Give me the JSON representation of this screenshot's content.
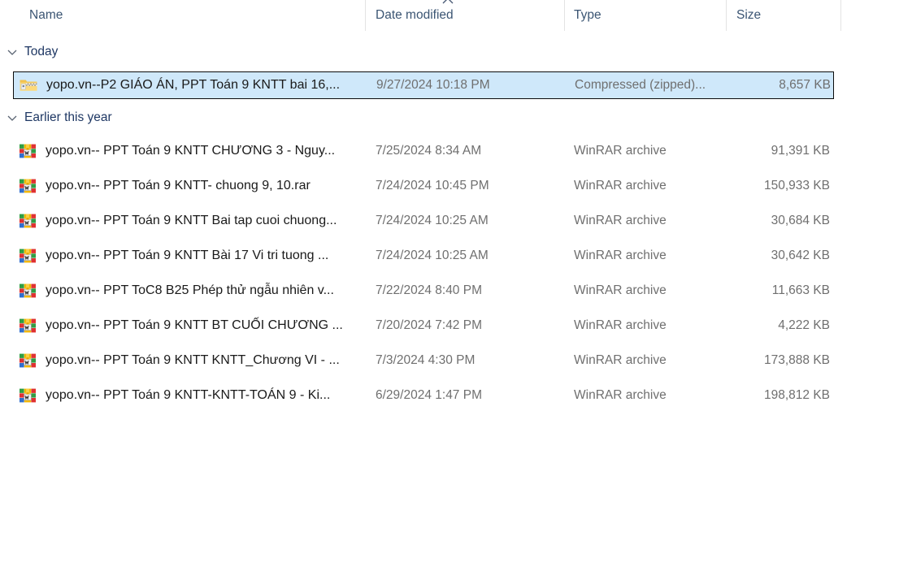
{
  "window": {
    "view": "details",
    "background_color": "#ffffff"
  },
  "colors": {
    "selection_fill": "#cfe8fa",
    "selection_border": "#0b0b0b",
    "header_text": "#3b5573",
    "group_header_text": "#1f3864",
    "name_text": "#1a1a1a",
    "secondary_text": "#6f6f6f",
    "divider": "#e3e3e3"
  },
  "columns": [
    {
      "key": "name",
      "label": "Name",
      "sorted": false
    },
    {
      "key": "date_modified",
      "label": "Date modified",
      "sorted": true,
      "sort_direction": "ascending",
      "sort_icon": "chevron-up-icon"
    },
    {
      "key": "type",
      "label": "Type",
      "sorted": false
    },
    {
      "key": "size",
      "label": "Size",
      "sorted": false
    }
  ],
  "groups": [
    {
      "label": "Today",
      "expanded": true,
      "chevron_icon": "chevron-down-icon",
      "items": [
        {
          "name": "yopo.vn--P2 GIÁO ÁN, PPT Toán 9 KNTT bai 16,...",
          "date_modified": "9/27/2024 10:18 PM",
          "type": "Compressed (zipped)...",
          "size": "8,657 KB",
          "icon": "zipped-folder-icon",
          "selected": true
        }
      ]
    },
    {
      "label": "Earlier this year",
      "expanded": true,
      "chevron_icon": "chevron-down-icon",
      "items": [
        {
          "name": "yopo.vn-- PPT Toán 9 KNTT CHƯƠNG 3 - Nguy...",
          "date_modified": "7/25/2024 8:34 AM",
          "type": "WinRAR archive",
          "size": "91,391 KB",
          "icon": "winrar-archive-icon",
          "selected": false
        },
        {
          "name": "yopo.vn-- PPT Toán 9 KNTT- chuong 9, 10.rar",
          "date_modified": "7/24/2024 10:45 PM",
          "type": "WinRAR archive",
          "size": "150,933 KB",
          "icon": "winrar-archive-icon",
          "selected": false
        },
        {
          "name": "yopo.vn-- PPT Toán 9 KNTT Bai tap cuoi chuong...",
          "date_modified": "7/24/2024 10:25 AM",
          "type": "WinRAR archive",
          "size": "30,684 KB",
          "icon": "winrar-archive-icon",
          "selected": false
        },
        {
          "name": "yopo.vn-- PPT Toán 9 KNTT Bài 17 Vi tri tuong ...",
          "date_modified": "7/24/2024 10:25 AM",
          "type": "WinRAR archive",
          "size": "30,642 KB",
          "icon": "winrar-archive-icon",
          "selected": false
        },
        {
          "name": "yopo.vn-- PPT ToC8 B25 Phép thử ngẫu nhiên v...",
          "date_modified": "7/22/2024 8:40 PM",
          "type": "WinRAR archive",
          "size": "11,663 KB",
          "icon": "winrar-archive-icon",
          "selected": false
        },
        {
          "name": "yopo.vn-- PPT Toán 9 KNTT  BT CUỐI CHƯƠNG ...",
          "date_modified": "7/20/2024 7:42 PM",
          "type": "WinRAR archive",
          "size": "4,222 KB",
          "icon": "winrar-archive-icon",
          "selected": false
        },
        {
          "name": "yopo.vn-- PPT Toán 9 KNTT KNTT_Chương VI - ...",
          "date_modified": "7/3/2024 4:30 PM",
          "type": "WinRAR archive",
          "size": "173,888 KB",
          "icon": "winrar-archive-icon",
          "selected": false
        },
        {
          "name": "yopo.vn-- PPT Toán 9 KNTT-KNTT-TOÁN 9 - Ki...",
          "date_modified": "6/29/2024 1:47 PM",
          "type": "WinRAR archive",
          "size": "198,812 KB",
          "icon": "winrar-archive-icon",
          "selected": false
        }
      ]
    }
  ]
}
